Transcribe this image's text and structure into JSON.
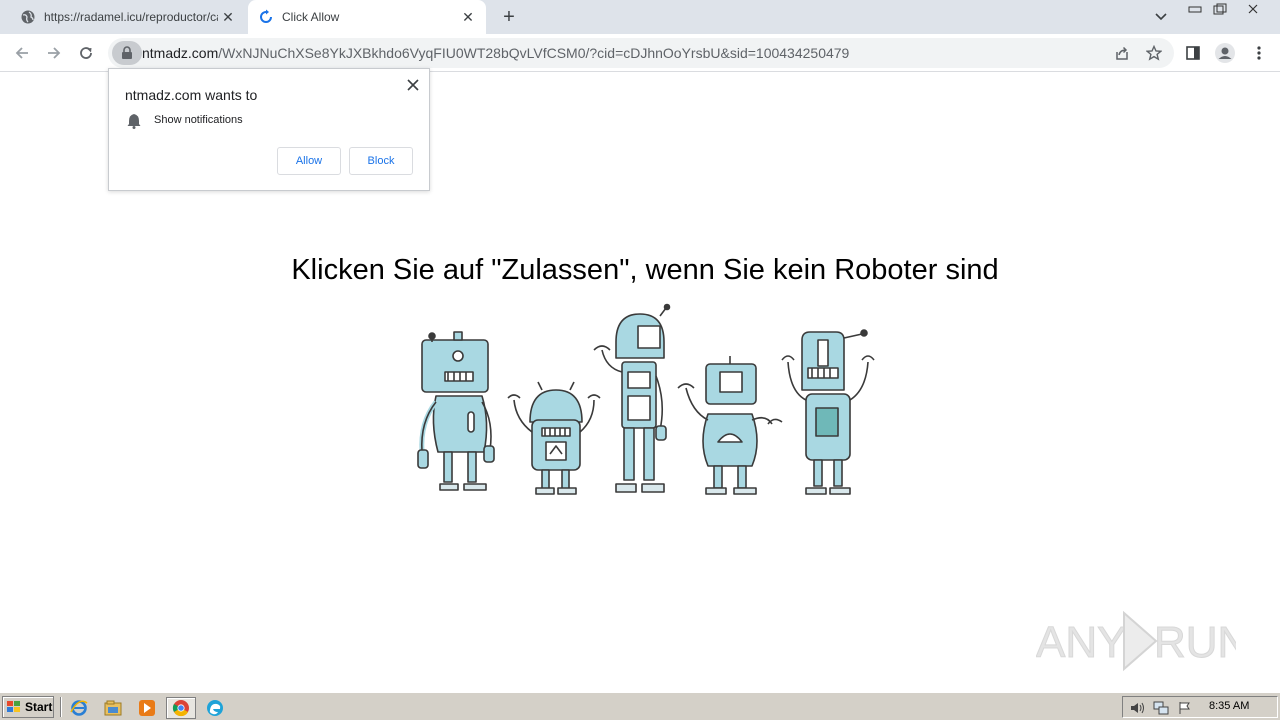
{
  "browser": {
    "tabs": [
      {
        "label": "https://radamel.icu/reproductor/can",
        "active": false
      },
      {
        "label": "Click Allow",
        "active": true
      }
    ],
    "new_tab_label": "+",
    "url": {
      "host": "ntmadz.com",
      "rest": "/WxNJNuChXSe8YkJXBkhdo6VyqFIU0WT28bQvLVfCSM0/?cid=cDJhnOoYrsbU&sid=100434250479"
    }
  },
  "permission_popup": {
    "title": "ntmadz.com wants to",
    "permission": "Show notifications",
    "allow_label": "Allow",
    "block_label": "Block"
  },
  "page": {
    "headline": "Klicken Sie auf \"Zulassen\", wenn Sie kein Roboter sind",
    "illustration": "five-cartoon-robots",
    "watermark": "ANY RUN"
  },
  "taskbar": {
    "start_label": "Start",
    "apps": [
      "ie-icon",
      "explorer-icon",
      "media-player-icon",
      "chrome-icon",
      "edge-icon"
    ],
    "clock": "8:35 AM"
  },
  "colors": {
    "tabbar_bg": "#dee3ea",
    "link_blue": "#1a73e8",
    "robot_fill": "#a9d8e2",
    "taskbar_bg": "#d4d0c8"
  }
}
